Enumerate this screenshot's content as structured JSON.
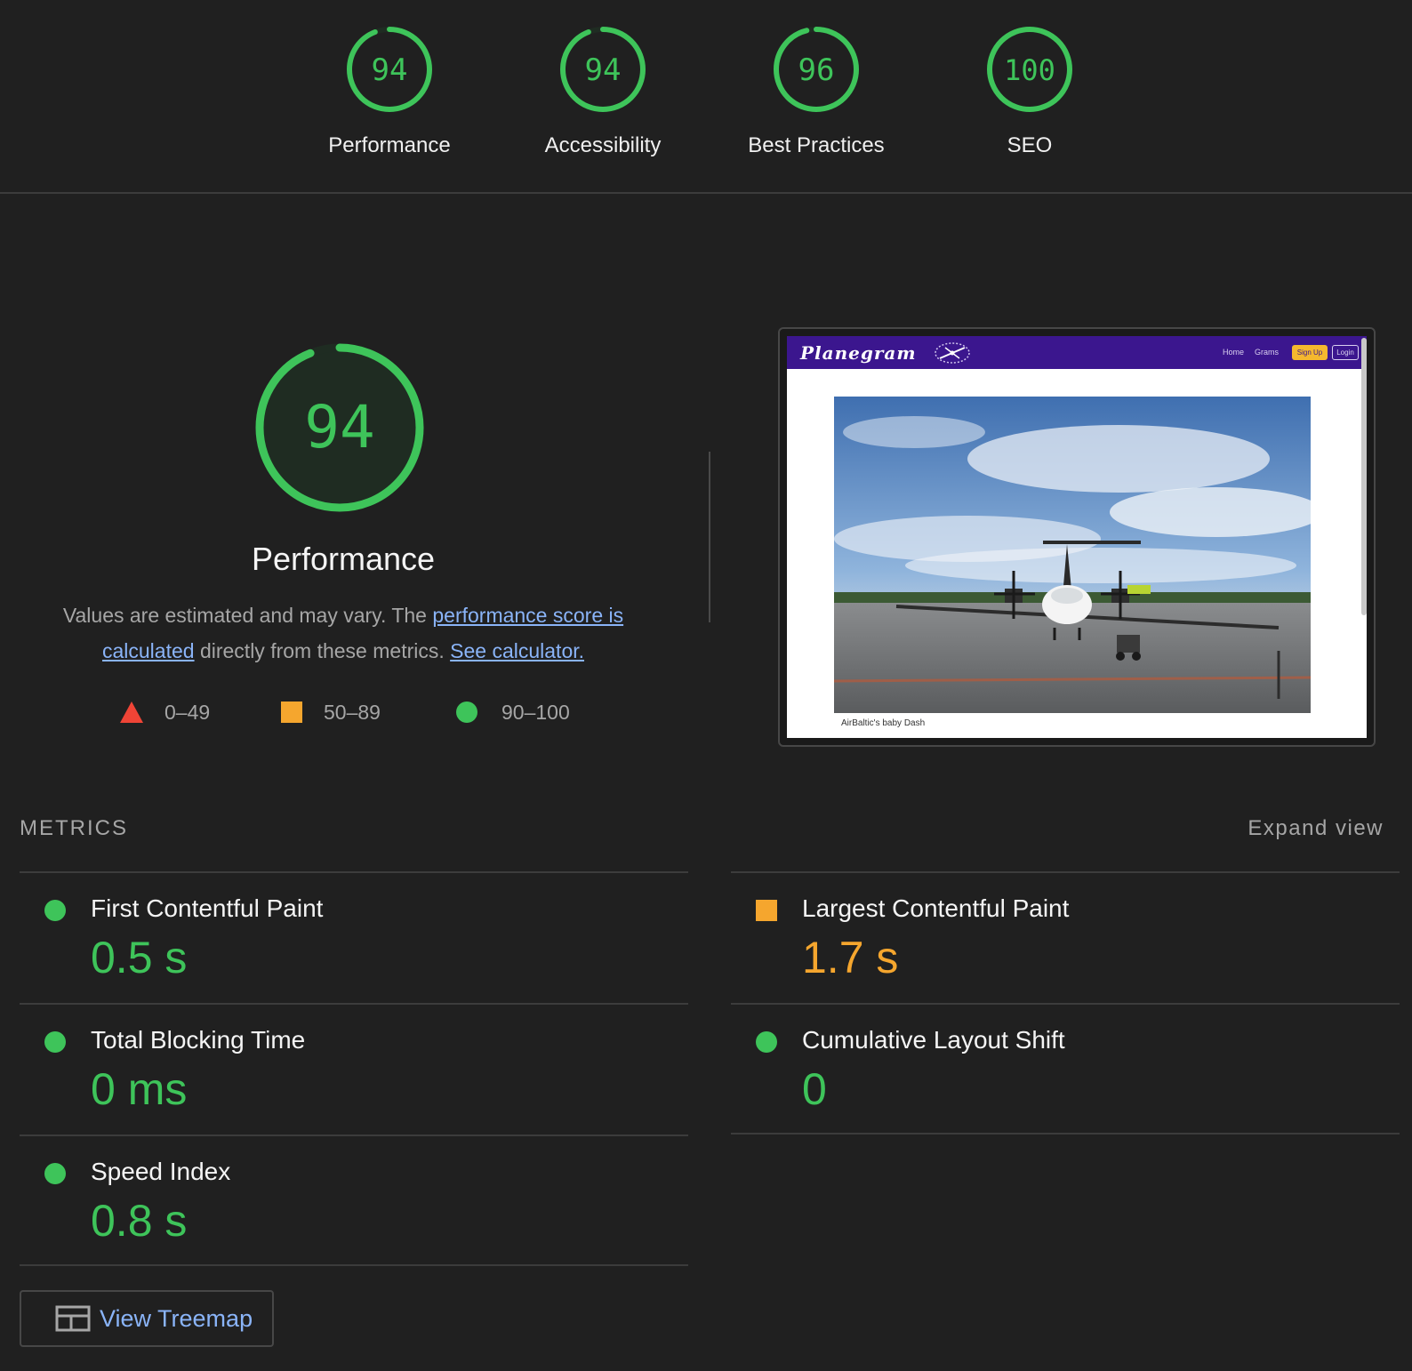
{
  "categories": [
    {
      "score": "94",
      "label": "Performance",
      "fraction": 0.94
    },
    {
      "score": "94",
      "label": "Accessibility",
      "fraction": 0.94
    },
    {
      "score": "96",
      "label": "Best Practices",
      "fraction": 0.96
    },
    {
      "score": "100",
      "label": "SEO",
      "fraction": 1.0
    }
  ],
  "colors": {
    "pass": "#3ec45a",
    "average": "#f5a62e",
    "fail": "#ef4436",
    "link": "#8ab4f8",
    "background": "#202020"
  },
  "hero": {
    "score": "94",
    "fraction": 0.94,
    "title": "Performance",
    "desc_prefix": "Values are estimated and may vary. The ",
    "desc_link1": "performance score is calculated",
    "desc_middle": " directly from these metrics. ",
    "desc_link2": "See calculator."
  },
  "legend": [
    {
      "icon": "triangle",
      "range": "0–49"
    },
    {
      "icon": "square",
      "range": "50–89"
    },
    {
      "icon": "circle",
      "range": "90–100"
    }
  ],
  "screenshot": {
    "site_title": "Planegram",
    "nav_links": [
      "Home",
      "Grams"
    ],
    "signup": "Sign Up",
    "login": "Login",
    "caption": "AirBaltic's baby Dash"
  },
  "metrics": {
    "heading": "METRICS",
    "expand_label": "Expand view",
    "items": [
      {
        "title": "First Contentful Paint",
        "value": "0.5 s",
        "rating": "pass"
      },
      {
        "title": "Largest Contentful Paint",
        "value": "1.7 s",
        "rating": "average"
      },
      {
        "title": "Total Blocking Time",
        "value": "0 ms",
        "rating": "pass"
      },
      {
        "title": "Cumulative Layout Shift",
        "value": "0",
        "rating": "pass"
      },
      {
        "title": "Speed Index",
        "value": "0.8 s",
        "rating": "pass"
      }
    ]
  },
  "treemap": {
    "label": "View Treemap",
    "icon": "treemap-icon"
  }
}
